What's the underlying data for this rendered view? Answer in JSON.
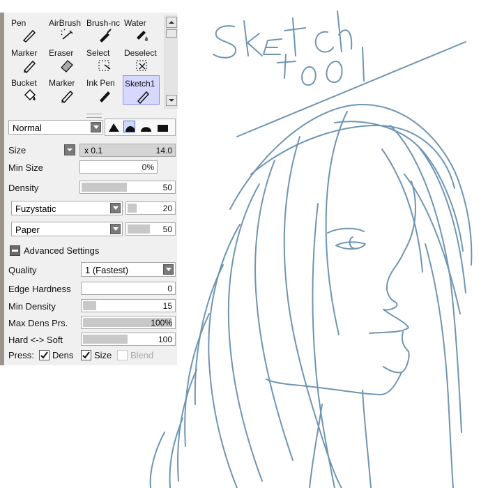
{
  "tools": [
    {
      "label": "Pen",
      "icon": "pen-icon"
    },
    {
      "label": "AirBrush",
      "icon": "airbrush-icon"
    },
    {
      "label": "Brush-nc",
      "icon": "brush-icon"
    },
    {
      "label": "Water",
      "icon": "water-icon"
    },
    {
      "label": "Marker",
      "icon": "marker-icon"
    },
    {
      "label": "Eraser",
      "icon": "eraser-icon"
    },
    {
      "label": "Select",
      "icon": "select-icon"
    },
    {
      "label": "Deselect",
      "icon": "deselect-icon"
    },
    {
      "label": "Bucket",
      "icon": "bucket-icon"
    },
    {
      "label": "Marker",
      "icon": "marker-icon"
    },
    {
      "label": "Ink Pen",
      "icon": "ink-pen-icon"
    },
    {
      "label": "Sketch1",
      "icon": "sketch-icon",
      "selected": true
    }
  ],
  "blend_mode": "Normal",
  "size": {
    "label": "Size",
    "multiplier": "x 0.1",
    "value": "14.0"
  },
  "min_size": {
    "label": "Min Size",
    "value": "0%"
  },
  "density": {
    "label": "Density",
    "value": "50",
    "fraction": 0.5
  },
  "texture1": {
    "name": "Fuzystatic",
    "value": "20",
    "fraction": 0.2
  },
  "texture2": {
    "name": "Paper",
    "value": "50",
    "fraction": 0.5
  },
  "advanced": {
    "label": "Advanced Settings"
  },
  "quality": {
    "label": "Quality",
    "value": "1 (Fastest)"
  },
  "edge_hardness": {
    "label": "Edge Hardness",
    "value": "0",
    "fraction": 0
  },
  "min_density": {
    "label": "Min Density",
    "value": "15",
    "fraction": 0.15
  },
  "max_dens_prs": {
    "label": "Max Dens Prs.",
    "value": "100%",
    "fraction": 1.0
  },
  "hard_soft": {
    "label": "Hard <-> Soft",
    "value": "100",
    "fraction": 0.5
  },
  "press": {
    "label": "Press:",
    "dens": "Dens",
    "size": "Size",
    "blend": "Blend"
  },
  "canvas_text": {
    "line1": "Sketch",
    "line2": "tool"
  },
  "colors": {
    "sketch": "#6f95b2",
    "selected": "#d6d8ff"
  }
}
